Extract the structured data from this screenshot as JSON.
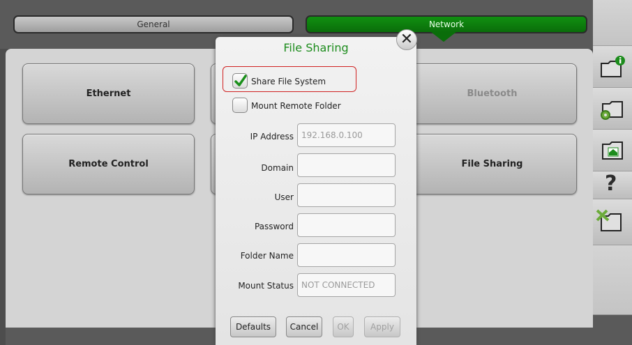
{
  "tabs": {
    "general": "General",
    "network": "Network"
  },
  "menu": {
    "ethernet": "Ethernet",
    "bluetooth": "Bluetooth",
    "remote_control": "Remote Control",
    "file_sharing": "File Sharing"
  },
  "sidebar": {
    "icons": [
      "folder-info-icon",
      "folder-settings-icon",
      "folder-home-icon",
      "help-icon",
      "folder-tools-icon"
    ],
    "help_glyph": "?"
  },
  "dialog": {
    "title": "File Sharing",
    "share_file_system": {
      "label": "Share File System",
      "checked": true
    },
    "mount_remote_folder": {
      "label": "Mount Remote Folder",
      "checked": false
    },
    "fields": {
      "ip_address": {
        "label": "IP Address",
        "value": "192.168.0.100"
      },
      "domain": {
        "label": "Domain",
        "value": ""
      },
      "user": {
        "label": "User",
        "value": ""
      },
      "password": {
        "label": "Password",
        "value": ""
      },
      "folder_name": {
        "label": "Folder Name",
        "value": ""
      },
      "mount_status": {
        "label": "Mount Status",
        "value": "NOT CONNECTED"
      }
    },
    "buttons": {
      "defaults": "Defaults",
      "cancel": "Cancel",
      "ok": "OK",
      "apply": "Apply"
    }
  },
  "colors": {
    "accent_green": "#1c8c1c",
    "network_tab": "#0a6d0a",
    "highlight_red": "#d02020"
  }
}
